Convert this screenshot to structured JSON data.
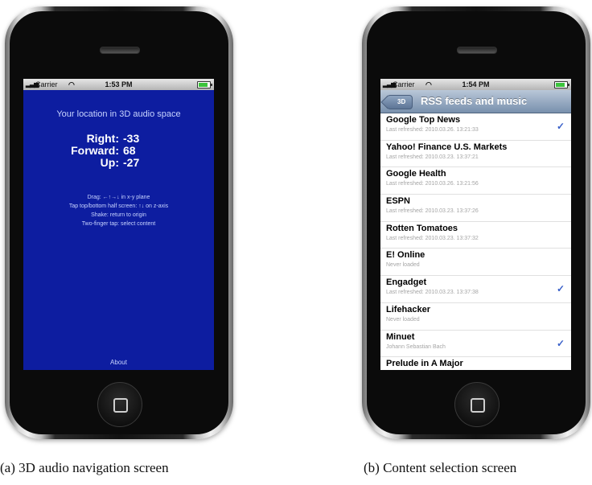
{
  "screen_a": {
    "status": {
      "carrier": "Carrier",
      "time": "1:53 PM"
    },
    "title": "Your location in 3D audio space",
    "coords": [
      {
        "label": "Right:",
        "value": "-33"
      },
      {
        "label": "Forward:",
        "value": "68"
      },
      {
        "label": "Up:",
        "value": "-27"
      }
    ],
    "help": [
      "Drag: ←↑→↓ in x-y plane",
      "Tap top/bottom half screen: ↑↓ on z-axis",
      "Shake: return to origin",
      "Two-finger tap: select content"
    ],
    "about": "About"
  },
  "screen_b": {
    "status": {
      "carrier": "Carrier",
      "time": "1:54 PM"
    },
    "back": "3D",
    "title": "RSS feeds and music",
    "items": [
      {
        "title": "Google Top News",
        "subtitle": "Last refreshed: 2010.03.26. 13:21:33",
        "checked": true
      },
      {
        "title": "Yahoo! Finance U.S. Markets",
        "subtitle": "Last refreshed: 2010.03.23. 13:37:21",
        "checked": false
      },
      {
        "title": "Google Health",
        "subtitle": "Last refreshed: 2010.03.26. 13:21:56",
        "checked": false
      },
      {
        "title": "ESPN",
        "subtitle": "Last refreshed: 2010.03.23. 13:37:26",
        "checked": false
      },
      {
        "title": "Rotten Tomatoes",
        "subtitle": "Last refreshed: 2010.03.23. 13:37:32",
        "checked": false
      },
      {
        "title": "E! Online",
        "subtitle": "Never loaded",
        "checked": false
      },
      {
        "title": "Engadget",
        "subtitle": "Last refreshed: 2010.03.23. 13:37:38",
        "checked": true
      },
      {
        "title": "Lifehacker",
        "subtitle": "Never loaded",
        "checked": false
      },
      {
        "title": "Minuet",
        "subtitle": "Johann Sebastian Bach",
        "checked": true
      },
      {
        "title": "Prelude in A Major",
        "subtitle": "",
        "checked": false
      }
    ]
  },
  "captions": {
    "a": "(a) 3D audio navigation screen",
    "b": "(b) Content selection screen"
  },
  "check_glyph": "✓",
  "colors": {
    "screen_a_bg": "#0d1da0",
    "check": "#3960c9",
    "battery": "#3cc43c"
  }
}
